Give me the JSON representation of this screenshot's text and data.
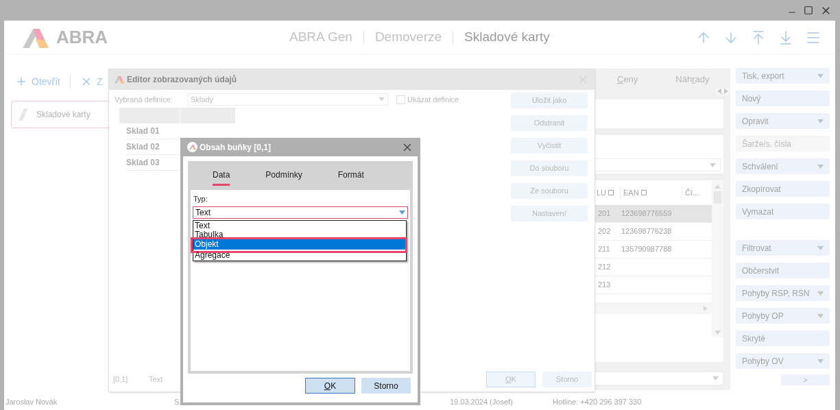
{
  "header": {
    "logo": "ABRA",
    "breadcrumbs": [
      {
        "label": "ABRA Gen",
        "selected": false
      },
      {
        "label": "Demoverze",
        "selected": false
      },
      {
        "label": "Skladové karty",
        "selected": true
      }
    ]
  },
  "toolbar": [
    {
      "kind": "add",
      "label": "Otevřít"
    },
    {
      "kind": "close",
      "label": "Z"
    }
  ],
  "doc_tab": {
    "label": "Skladové karty",
    "selected": true
  },
  "detail_tabs": [
    {
      "key": "C",
      "after": "eny"
    },
    {
      "before": "Náh",
      "key": "r",
      "after": "ady"
    }
  ],
  "table": {
    "columns": [
      {
        "label": "LU",
        "filter": true
      },
      {
        "label": "EAN",
        "filter": true
      },
      {
        "label": "Čí...",
        "filter": false
      }
    ],
    "rows": [
      {
        "cells": [
          "201",
          "123698776559"
        ],
        "selected": true
      },
      {
        "cells": [
          "202",
          "123698776238"
        ],
        "selected": false
      },
      {
        "cells": [
          "211",
          "135790987788"
        ],
        "selected": false
      },
      {
        "cells": [
          "212",
          ""
        ],
        "selected": false
      },
      {
        "cells": [
          "213",
          ""
        ],
        "selected": false
      }
    ]
  },
  "side_groups": [
    [
      {
        "label": "Tisk, export",
        "dropdown": true,
        "disabled": false
      },
      {
        "label": "Nový",
        "dropdown": false,
        "disabled": false
      },
      {
        "label": "Opravit",
        "dropdown": true,
        "disabled": false
      },
      {
        "label": "Šarže/s. čísla",
        "dropdown": false,
        "disabled": true
      },
      {
        "label": "Schválení",
        "dropdown": true,
        "disabled": false
      },
      {
        "label": "Zkopírovat",
        "dropdown": false,
        "disabled": false
      },
      {
        "label": "Vymazat",
        "dropdown": false,
        "disabled": false
      }
    ],
    [
      {
        "label": "Filtrovat",
        "dropdown": true,
        "disabled": false
      },
      {
        "label": "Občerstvit",
        "dropdown": false,
        "disabled": false
      },
      {
        "label": "Pohyby RSP, RSN",
        "dropdown": true,
        "disabled": false
      },
      {
        "label": "Pohyby OP",
        "dropdown": true,
        "disabled": false
      },
      {
        "label": "Skryté",
        "dropdown": false,
        "disabled": false
      },
      {
        "label": "Pohyby OV",
        "dropdown": true,
        "disabled": false
      }
    ]
  ],
  "next_button": ">",
  "status_bar": [
    "Jaroslav Novák",
    "S",
    "19.03.2024 (Josef)",
    "Hotline: +420 296 397 330"
  ],
  "editor_dialog": {
    "title": "Editor zobrazovaných údajů",
    "definition_label": "Vybraná definice:",
    "definition_value": "Sklady",
    "show_definition": {
      "label": "Ukázat definice",
      "checked": false
    },
    "rows": [
      "Sklad 01",
      "Sklad 02",
      "Sklad 03"
    ],
    "buttons": [
      "Uložit jako",
      "Odstranit",
      "Vyčistit",
      "Do souboru",
      "Ze souboru",
      "Nastavení"
    ],
    "position": "[0,1]",
    "cell_type": "Text",
    "ok": {
      "key": "O",
      "after": "K"
    },
    "cancel": "Storno"
  },
  "cell_dialog": {
    "title": "Obsah buňky [0,1]",
    "tabs": [
      {
        "label": "Data",
        "selected": true
      },
      {
        "label": "Podmínky",
        "selected": false
      },
      {
        "label": "Formát",
        "selected": false
      }
    ],
    "type_label": "Typ:",
    "type_value": "Text",
    "options": [
      {
        "label": "Text",
        "selected": false,
        "highlighted": false
      },
      {
        "label": "Tabulka",
        "selected": false,
        "highlighted": false
      },
      {
        "label": "Objekt",
        "selected": true,
        "highlighted": true
      },
      {
        "label": "Agregace",
        "selected": false,
        "highlighted": false
      }
    ],
    "ok": {
      "key": "O",
      "after": "K"
    },
    "cancel": "Storno"
  }
}
